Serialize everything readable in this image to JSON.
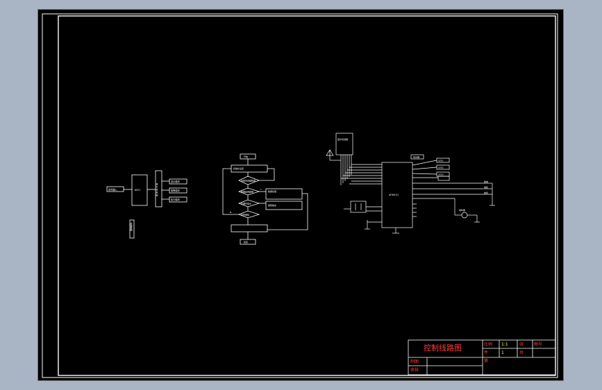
{
  "drawing": {
    "background": "#000000",
    "frame_color": "#ffffff",
    "line_color": "#ffffff",
    "title_color": "#ff3b3b",
    "accent_color": "#ffff66"
  },
  "block_diagram": {
    "input_label": "信号输入",
    "core_label": "8051",
    "side_label": "单 片 机 控 制",
    "outputs": [
      "显示模块",
      "报警模块",
      "执行模块"
    ],
    "caption": "原理框图"
  },
  "flowchart": {
    "start_label": "开始",
    "end_label": "结束",
    "steps": [
      "初始化设置",
      "读取传感器数据",
      "数据是否超限",
      "处理并显示",
      "是否继续"
    ],
    "note_boxes": [
      "数据处理",
      "报警输出"
    ],
    "yes_label": "Y",
    "no_label": "N"
  },
  "schematic": {
    "chip_label": "AT89C51",
    "sensor_label": "霍尔传感器",
    "module_label": "显示器",
    "relay_labels": [
      "LED1",
      "LED2",
      "LED3"
    ],
    "output_labels": [
      "继电",
      "电机",
      "蜂鸣"
    ],
    "speaker_label": "蜂鸣器"
  },
  "title_block": {
    "title": "控制线路图",
    "row1": [
      "比例",
      "1:1",
      "张",
      "图号"
    ],
    "row2": [
      "件",
      "1",
      "共",
      ""
    ],
    "row3_label": "第",
    "maker_label": "制图",
    "checker_label": "审核"
  }
}
